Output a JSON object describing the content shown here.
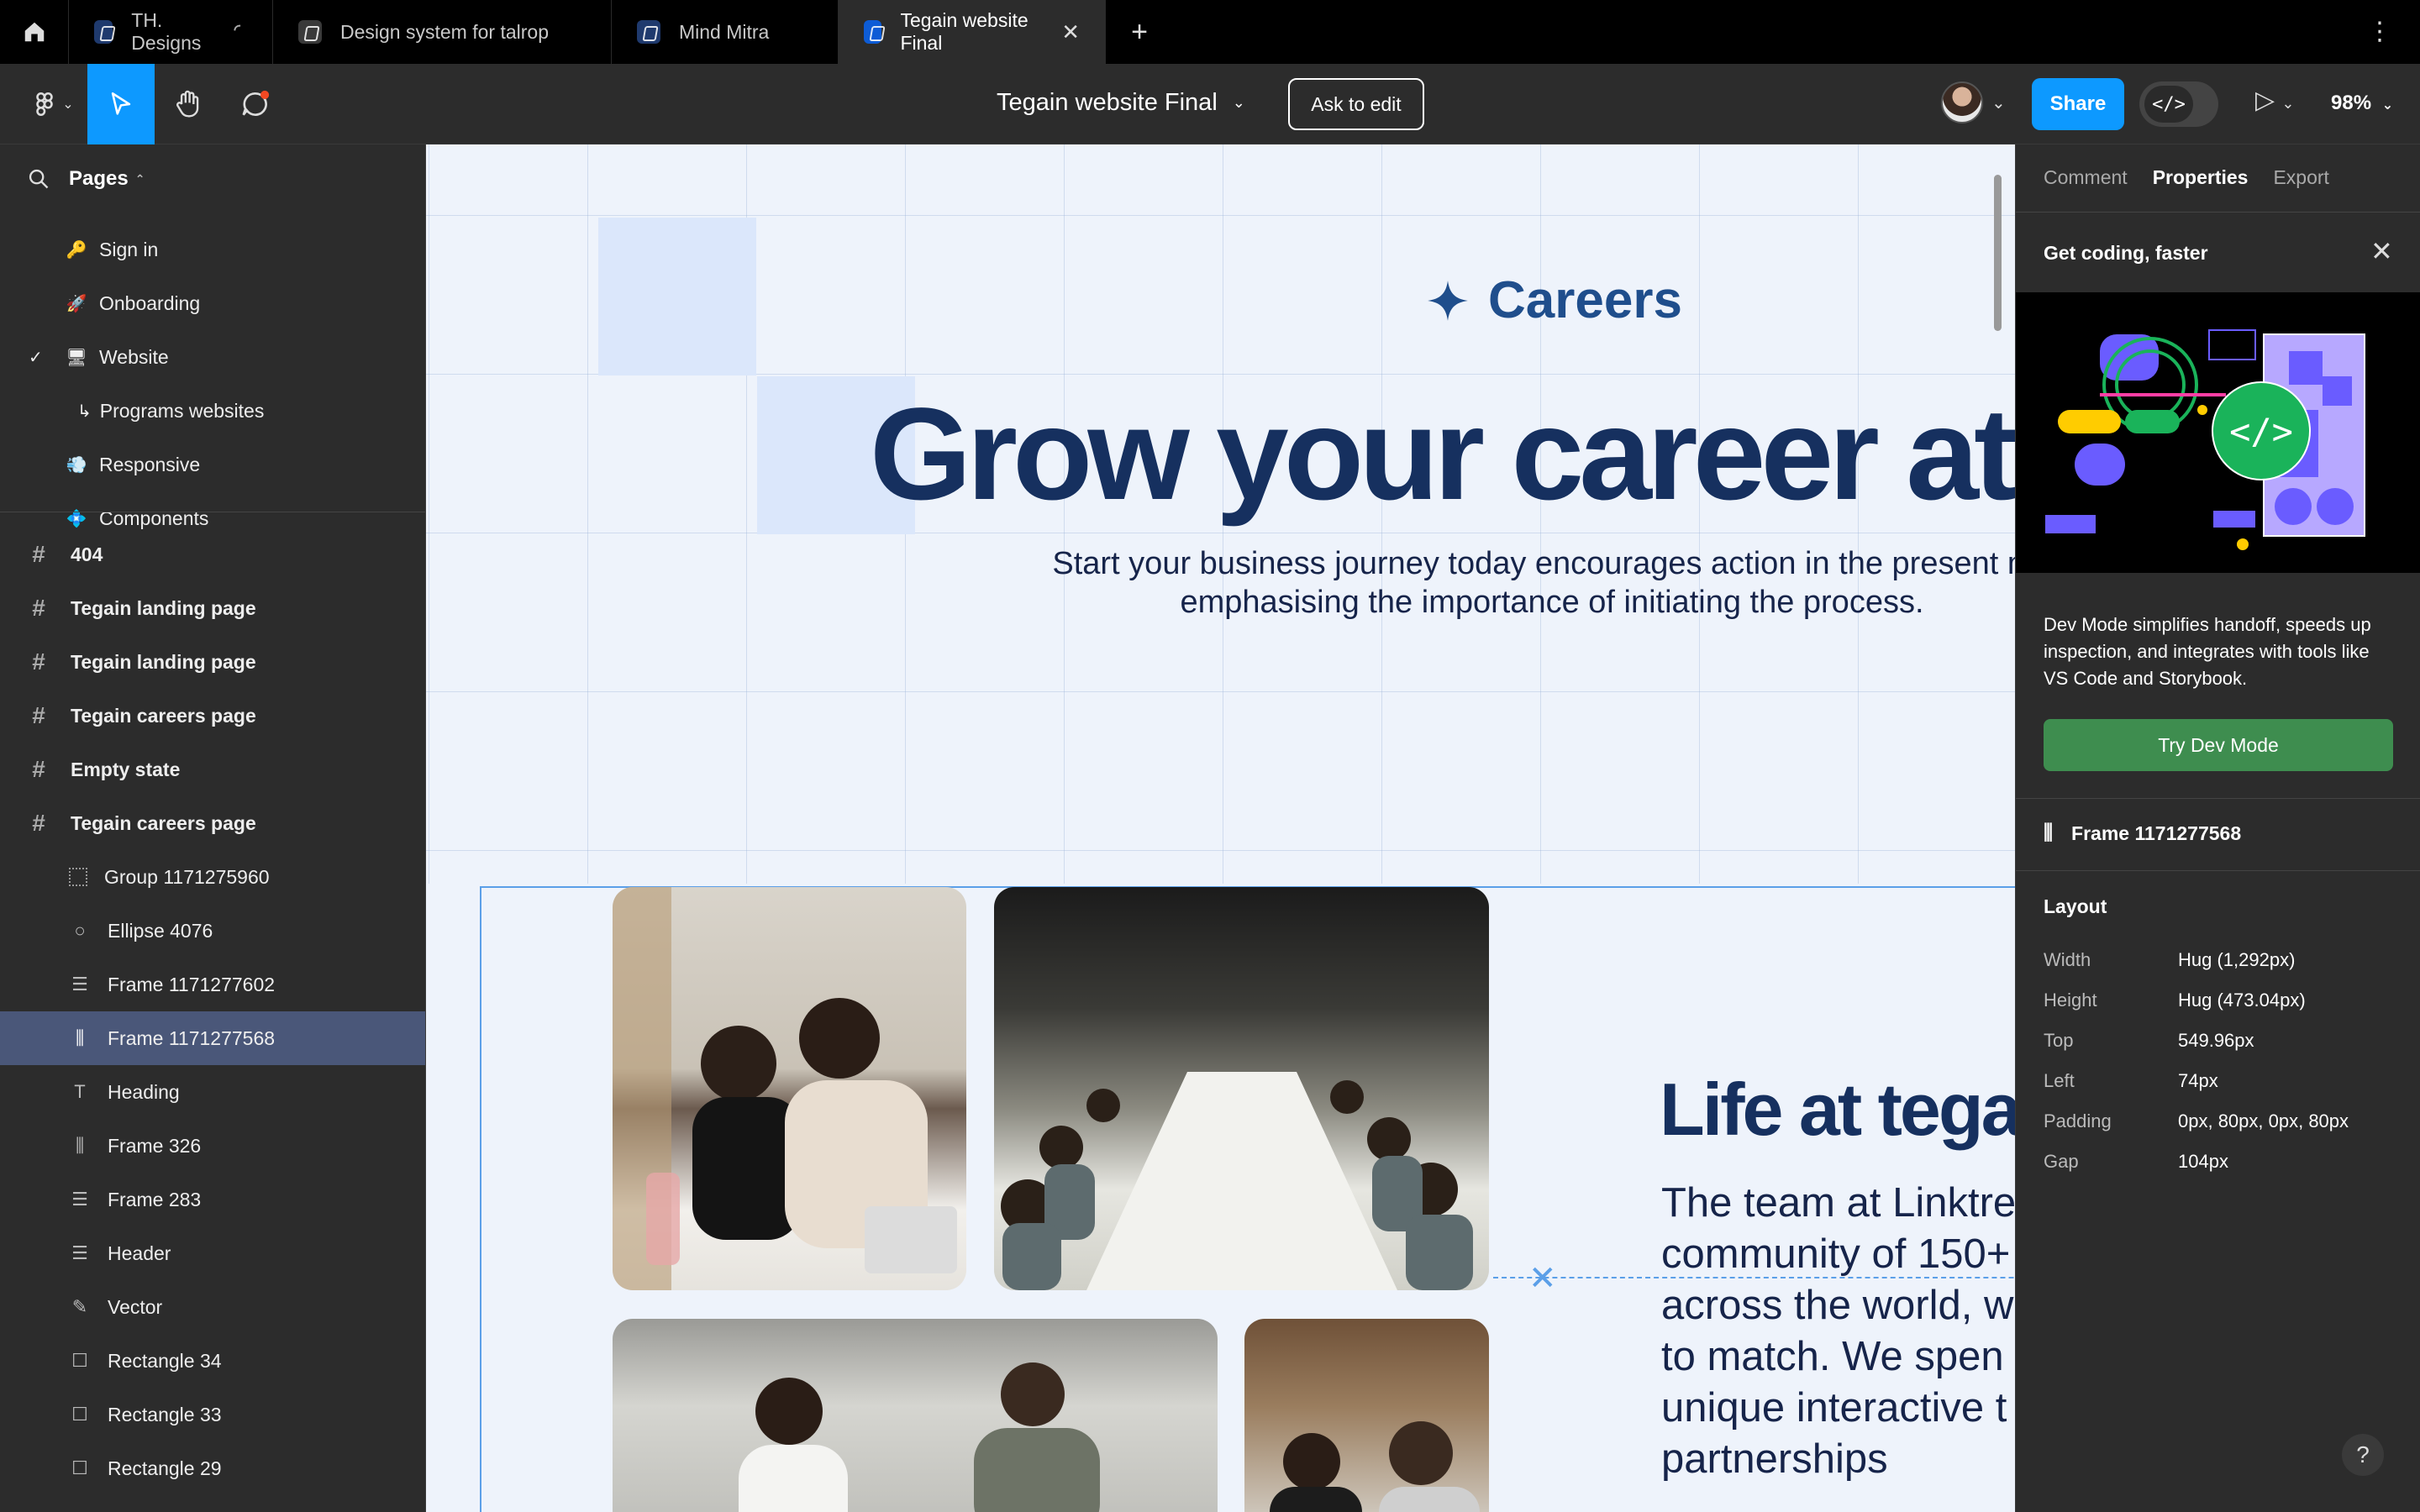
{
  "tabs": [
    {
      "title": "TH. Designs",
      "loading": true
    },
    {
      "title": "Design system for talrop"
    },
    {
      "title": "Mind Mitra"
    },
    {
      "title": "Tegain website Final",
      "active": true
    }
  ],
  "toolbar": {
    "doc_title": "Tegain website Final",
    "ask_to_edit": "Ask to edit",
    "share": "Share",
    "dev_mode_glyph": "</>",
    "zoom": "98%"
  },
  "pages": {
    "header": "Pages",
    "items": [
      {
        "icon": "🔑",
        "label": "Sign in"
      },
      {
        "icon": "🚀",
        "label": "Onboarding"
      },
      {
        "icon": "🖥",
        "label": "Website",
        "current": true
      },
      {
        "icon": "↳",
        "label": "Programs websites"
      },
      {
        "icon": "💨",
        "label": "Responsive"
      },
      {
        "icon": "💠",
        "label": "Components"
      }
    ]
  },
  "layers": {
    "frames": [
      "404",
      "Tegain landing page",
      "Tegain landing page",
      "Tegain careers page",
      "Empty state",
      "Tegain careers page"
    ],
    "children": [
      {
        "icon": "group-icon",
        "label": "Group 1171275960"
      },
      {
        "icon": "ellipse-icon",
        "label": "Ellipse 4076"
      },
      {
        "icon": "vertical-layout-icon",
        "label": "Frame 1171277602"
      },
      {
        "icon": "horizontal-layout-icon",
        "label": "Frame 1171277568",
        "selected": true
      },
      {
        "icon": "text-icon",
        "label": "Heading"
      },
      {
        "icon": "horizontal-layout-icon",
        "label": "Frame 326"
      },
      {
        "icon": "vertical-layout-icon",
        "label": "Frame 283"
      },
      {
        "icon": "vertical-layout-icon",
        "label": "Header"
      },
      {
        "icon": "vector-icon",
        "label": "Vector"
      },
      {
        "icon": "rectangle-icon",
        "label": "Rectangle 34"
      },
      {
        "icon": "rectangle-icon",
        "label": "Rectangle 33"
      },
      {
        "icon": "rectangle-icon",
        "label": "Rectangle 29"
      }
    ]
  },
  "canvas": {
    "careers_label": "Careers",
    "hero_heading": "Grow your career at te",
    "subtitle_line1": "Start your business journey today encourages action in the present mo",
    "subtitle_line2": "emphasising the importance of initiating the process.",
    "life_heading": "Life at tega",
    "body_lines": [
      "The team at Linktre",
      "community of 150+",
      "across the world, w",
      "to match. We spen",
      "unique interactive t",
      "partnerships"
    ]
  },
  "right_panel": {
    "tabs": [
      "Comment",
      "Properties",
      "Export"
    ],
    "active_tab": "Properties",
    "promo_title": "Get coding, faster",
    "promo_text": "Dev Mode simplifies handoff, speeds up inspection, and integrates with tools like VS Code and Storybook.",
    "promo_button": "Try Dev Mode",
    "frame_name": "Frame 1171277568",
    "layout_header": "Layout",
    "properties": [
      {
        "label": "Width",
        "value": "Hug (1,292px)"
      },
      {
        "label": "Height",
        "value": "Hug (473.04px)"
      },
      {
        "label": "Top",
        "value": "549.96px"
      },
      {
        "label": "Left",
        "value": "74px"
      },
      {
        "label": "Padding",
        "value": "0px, 80px, 0px, 80px"
      },
      {
        "label": "Gap",
        "value": "104px"
      }
    ],
    "help": "?"
  },
  "colors": {
    "accent": "#0d99ff",
    "dev_green": "#3e8d4f",
    "heading_navy": "#16305f",
    "selection_row": "#4a5779"
  }
}
